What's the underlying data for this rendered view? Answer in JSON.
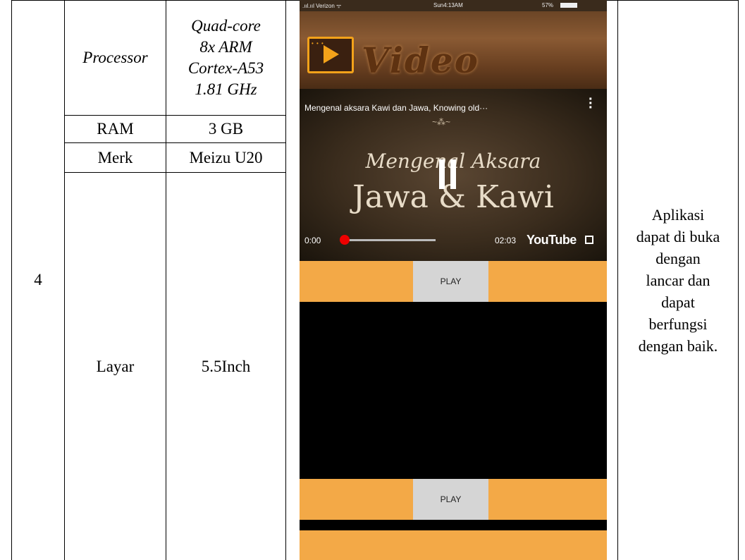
{
  "table": {
    "number": "4",
    "rows": [
      {
        "label": "Processor",
        "value_lines": [
          "Quad-core",
          "8x ARM",
          "Cortex-A53",
          "1.81 GHz"
        ]
      },
      {
        "label": "RAM",
        "value": "3 GB"
      },
      {
        "label": "Merk",
        "value": "Meizu U20"
      },
      {
        "label": "Layar",
        "value": "5.5Inch"
      }
    ],
    "result_lines": [
      "Aplikasi",
      "dapat di buka",
      "dengan",
      "lancar dan",
      "dapat",
      "berfungsi",
      "dengan baik."
    ]
  },
  "phone": {
    "status": {
      "carrier": ".ııl.ııl Verizon ᯤ",
      "time": "Sun4:13AM",
      "battery": "57%"
    },
    "app_title": "Video",
    "video": {
      "title": "Mengenal  aksara Kawi dan Jawa, Knowing old···",
      "ornament": "~⁂~",
      "caption_line1": "Mengenal Aksara",
      "caption_line2": "Jawa & Kawi",
      "current_time": "0:00",
      "duration": "02:03",
      "brand": "YouTube",
      "progress": 0.0
    },
    "buttons": [
      {
        "label": "PLAY"
      },
      {
        "label": "PLAY"
      }
    ]
  }
}
